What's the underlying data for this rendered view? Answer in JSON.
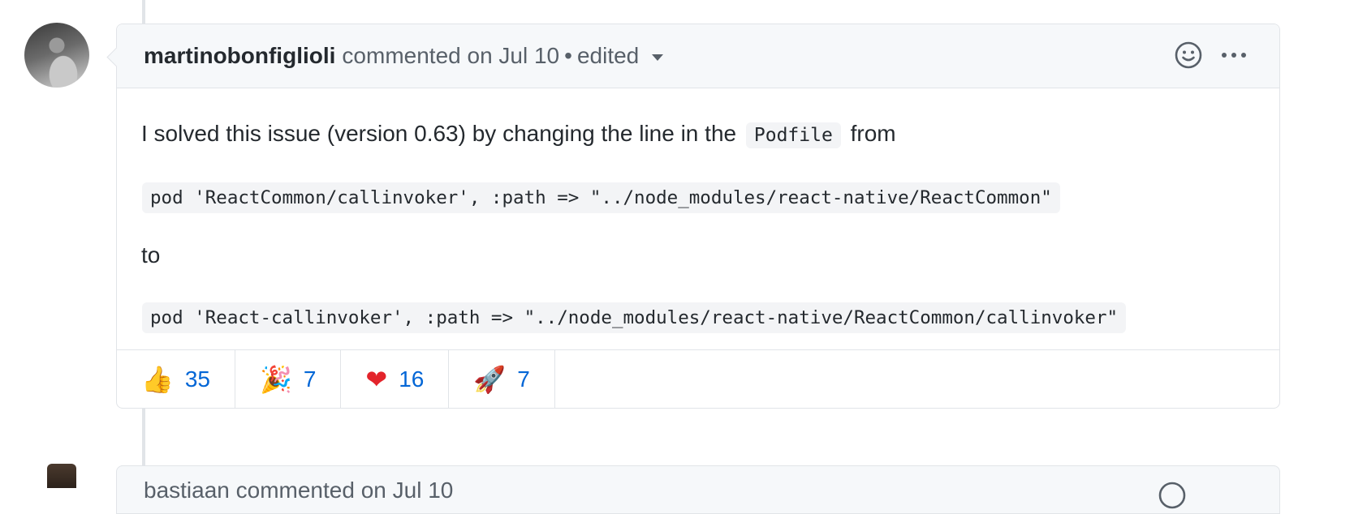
{
  "comment": {
    "author": "martinobonfiglioli",
    "action_text": "commented on Jul 10",
    "separator": "•",
    "edited_label": "edited",
    "body": {
      "para1_before": "I solved this issue (version 0.63) by changing the line in the",
      "para1_code": "Podfile",
      "para1_after": "from",
      "code_old": "pod 'ReactCommon/callinvoker', :path => \"../node_modules/react-native/ReactCommon\"",
      "para2": "to",
      "code_new": "pod 'React-callinvoker', :path => \"../node_modules/react-native/ReactCommon/callinvoker\""
    },
    "reactions": [
      {
        "icon": "thumbs-up-icon",
        "glyph": "👍",
        "count": "35"
      },
      {
        "icon": "party-popper-icon",
        "glyph": "🎉",
        "count": "7"
      },
      {
        "icon": "heart-icon",
        "glyph": "❤",
        "count": "16"
      },
      {
        "icon": "rocket-icon",
        "glyph": "🚀",
        "count": "7"
      }
    ]
  },
  "next_comment": {
    "header_partial": "bastiaan  commented on Jul 10"
  },
  "colors": {
    "link_blue": "#0366d6",
    "border": "#e1e4e8",
    "header_bg": "#f6f8fa",
    "code_bg": "#f3f4f6"
  }
}
